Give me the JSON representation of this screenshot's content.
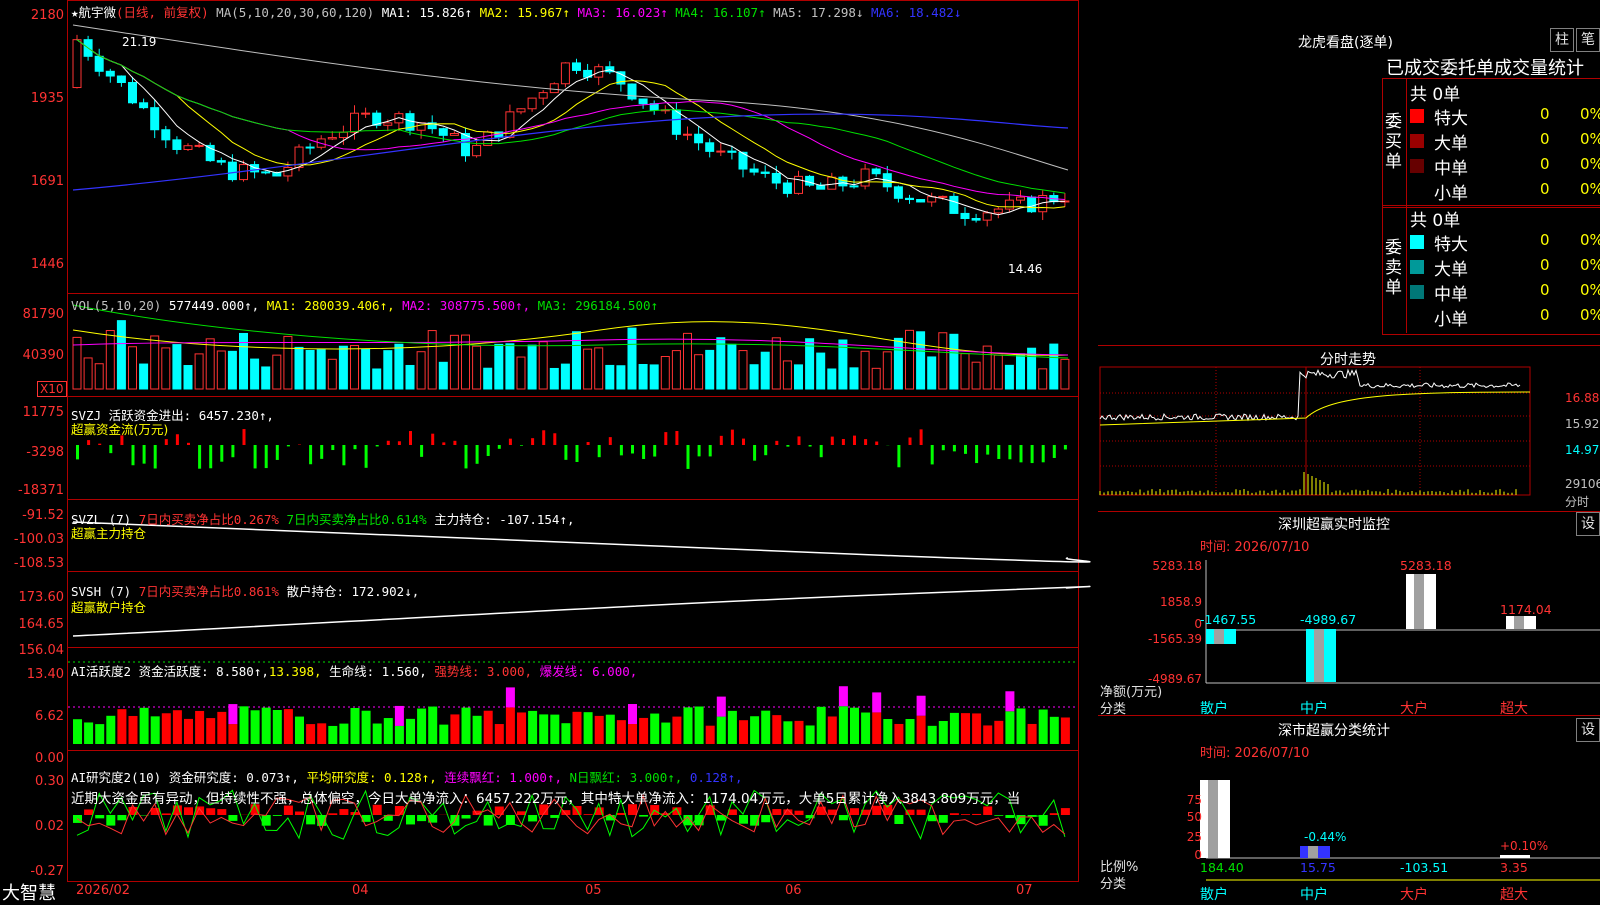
{
  "stock": {
    "name": "★航宇微",
    "mode": "(日线, 前复权)"
  },
  "main_header": {
    "ma": "MA(5,10,20,30,60,120)",
    "ma1": "MA1: 15.826↑",
    "ma2": "MA2: 15.967↑",
    "ma3": "MA3: 16.023↑",
    "ma4": "MA4: 16.107↑",
    "ma5": "MA5: 17.298↓",
    "ma6": "MA6: 18.482↓"
  },
  "main_axis": [
    "2180",
    "1935",
    "1691",
    "1446"
  ],
  "main_marks": {
    "high": "21.19",
    "low": "14.46"
  },
  "vol_header": {
    "title": "VOL(5,10,20)",
    "value": "577449.000↑,",
    "ma1": "MA1: 280039.406↑,",
    "ma2": "MA2: 308775.500↑,",
    "ma3": "MA3: 296184.500↑"
  },
  "vol_axis": [
    "81790",
    "40390"
  ],
  "vol_unit": "X10",
  "svzj": {
    "title": "SVZJ",
    "label": "活跃资金进出: 6457.230↑,",
    "sub": "超赢资金流(万元)",
    "axis": [
      "11775",
      "-3298",
      "-18371"
    ]
  },
  "svzl": {
    "title": "SVZL (7)",
    "a": "7日内买卖净占比0.267%",
    "b": "7日内买卖净占比0.614%",
    "c": "主力持仓: -107.154↑,",
    "sub": "超赢主力持仓",
    "axis": [
      "-91.52",
      "-100.03",
      "-108.53"
    ]
  },
  "svsh": {
    "title": "SVSH (7)",
    "a": "7日内买卖净占比0.861%",
    "c": "散户持仓: 172.902↓,",
    "sub": "超赢散户持仓",
    "axis": [
      "173.60",
      "164.65",
      "156.04"
    ]
  },
  "ai1": {
    "title": "AI活跃度2",
    "a": "资金活跃度: 8.580↑,",
    "b": "13.398,",
    "c": "生命线: 1.560,",
    "d": "强势线: 3.000,",
    "e": "爆发线: 6.000,",
    "axis": [
      "13.40",
      "6.62",
      "0.00"
    ]
  },
  "ai2": {
    "title": "AI研究度2(10)",
    "a": "资金研究度: 0.073↑,",
    "b": "平均研究度: 0.128↑,",
    "c": "连续飘红: 1.000↑,",
    "d": "N日飘红: 3.000↑,",
    "e": "0.128↑,",
    "comment": "近期大资金虽有异动，但持续性不强，总体偏空，今日大单净流入：6457.222万元，其中特大单净流入：1174.04万元，大单5日累计净入3843.809万元，当",
    "axis": [
      "0.30",
      "0.02",
      "-0.27"
    ]
  },
  "bottom": {
    "brand": "大智慧",
    "dates": [
      "2026/02",
      "04",
      "05",
      "06",
      "07"
    ]
  },
  "lhb": {
    "title": "龙虎看盘(逐单)",
    "btn1": "柱",
    "btn2": "笔",
    "sub": "已成交委托单成交量统计",
    "buy": {
      "label": "委买单",
      "total": "共 0单",
      "rows": [
        {
          "name": "特大",
          "color": "#ff0000",
          "v1": "0",
          "v2": "0%"
        },
        {
          "name": "大单",
          "color": "#990000",
          "v1": "0",
          "v2": "0%"
        },
        {
          "name": "中单",
          "color": "#660000",
          "v1": "0",
          "v2": "0%"
        },
        {
          "name": "小单",
          "color": "#000000",
          "v1": "0",
          "v2": "0%"
        }
      ]
    },
    "sell": {
      "label": "委卖单",
      "total": "共 0单",
      "rows": [
        {
          "name": "特大",
          "color": "#00ffff",
          "v1": "0",
          "v2": "0%"
        },
        {
          "name": "大单",
          "color": "#009999",
          "v1": "0",
          "v2": "0%"
        },
        {
          "name": "中单",
          "color": "#007777",
          "v1": "0",
          "v2": "0%"
        },
        {
          "name": "小单",
          "color": "#000000",
          "v1": "0",
          "v2": "0%"
        }
      ]
    }
  },
  "intraday": {
    "title": "分时走势",
    "axis": [
      "16.88",
      "15.92",
      "14.97"
    ],
    "vol": "29106",
    "unit": "分时"
  },
  "monitor": {
    "title": "深圳超赢实时监控",
    "btn": "设",
    "time": "时间: 2026/07/10",
    "axis": [
      "5283.18",
      "1858.9",
      "0",
      "-1565.39",
      "-4989.67"
    ],
    "ylabel": "净额(万元)",
    "xlabel": "分类",
    "cats": [
      "散户",
      "中户",
      "大户",
      "超大"
    ],
    "values": [
      "-1467.55",
      "-4989.67",
      "5283.18",
      "1174.04"
    ]
  },
  "classify": {
    "title": "深市超赢分类统计",
    "btn": "设",
    "time": "时间: 2026/07/10",
    "axis": [
      "75",
      "50",
      "25",
      "0"
    ],
    "ylabel": "比例%",
    "xlabel": "分类",
    "cats": [
      "散户",
      "中户",
      "大户",
      "超大"
    ],
    "values": [
      "184.40",
      "15.75",
      "-103.51",
      "3.35"
    ],
    "pct": [
      "-0.44%",
      "+0.10%"
    ]
  }
}
